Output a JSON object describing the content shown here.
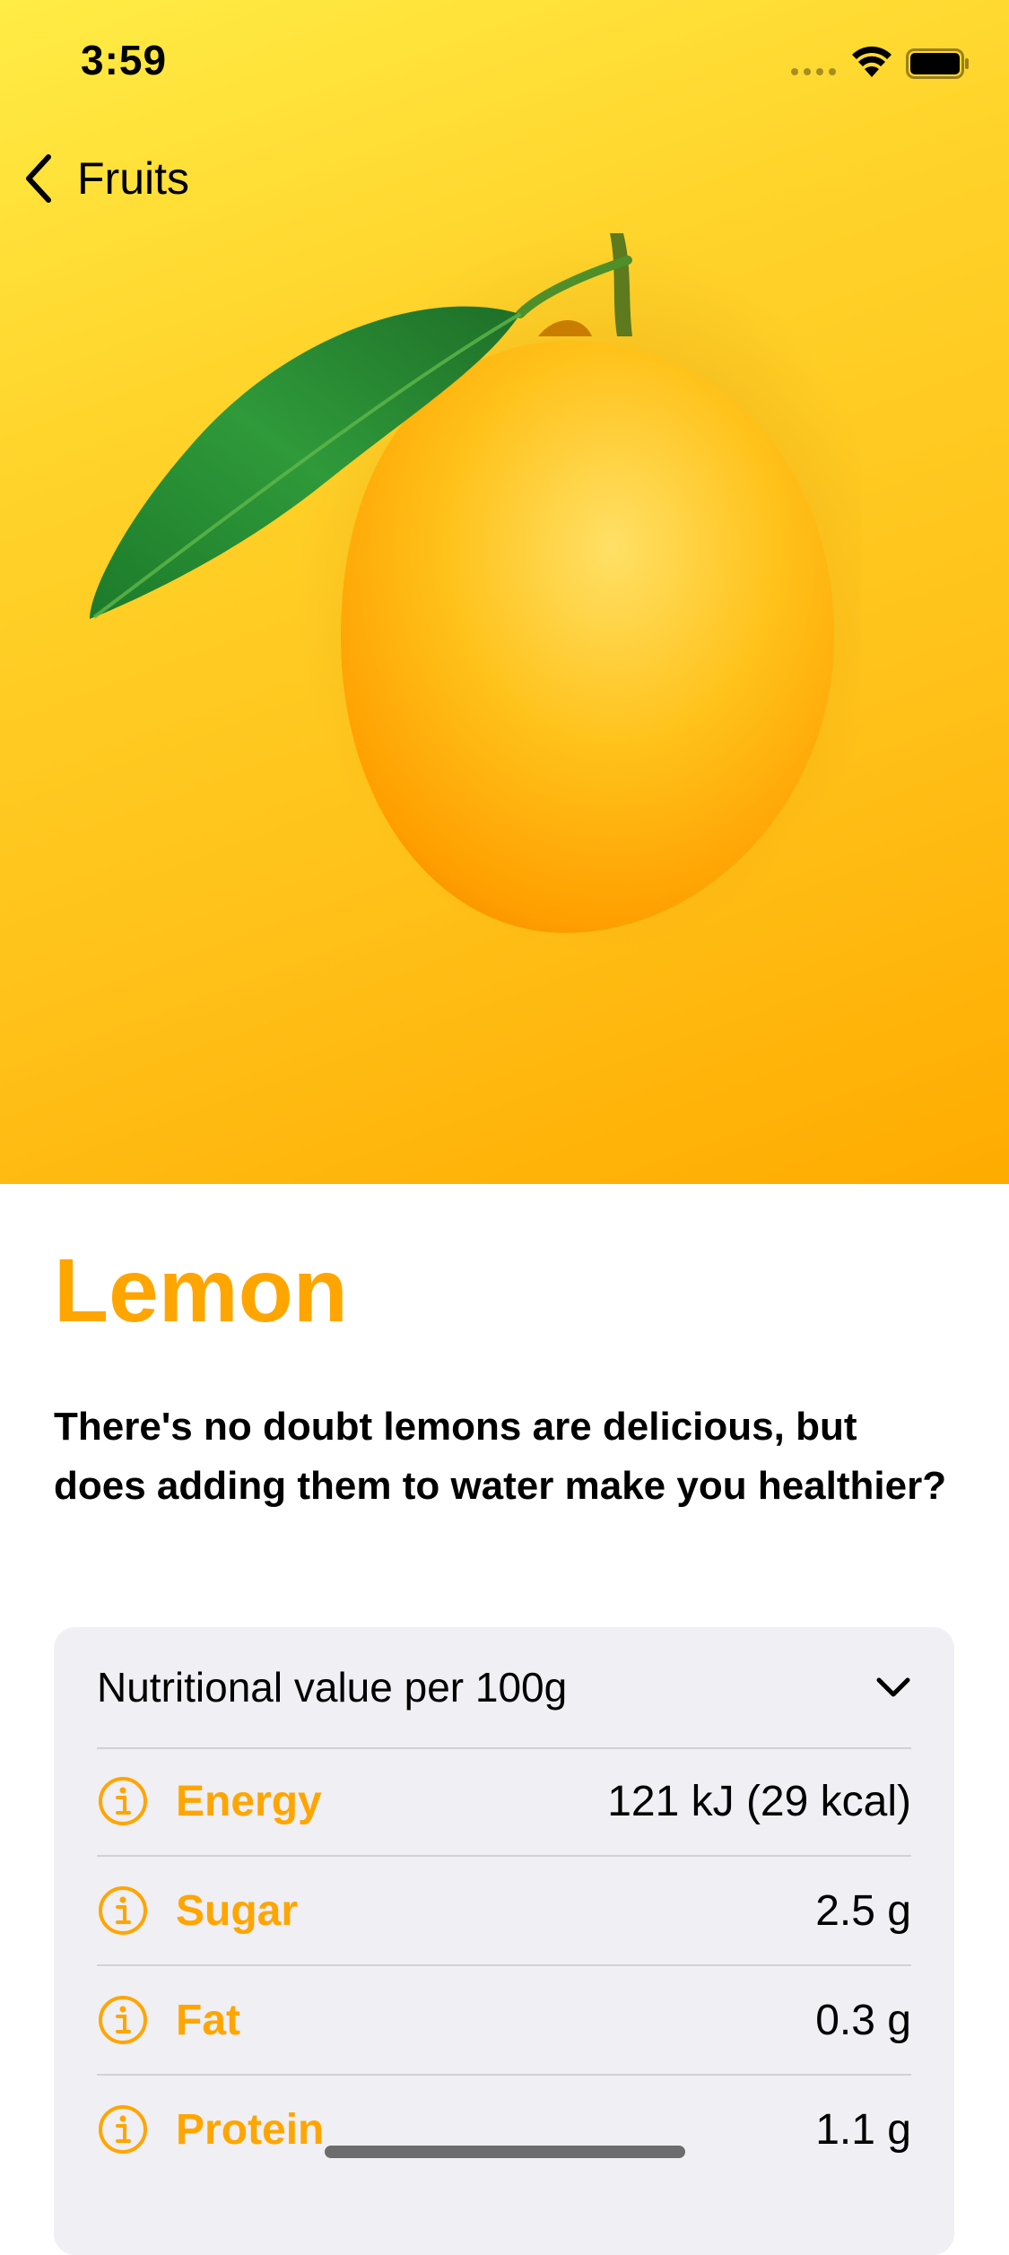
{
  "status_bar": {
    "time": "3:59"
  },
  "nav": {
    "back_label": "Fruits"
  },
  "fruit": {
    "name": "Lemon",
    "description": "There's no doubt lemons are delicious, but does adding them to water make you healthier?"
  },
  "nutrition": {
    "header": "Nutritional value per 100g",
    "rows": [
      {
        "label": "Energy",
        "value": "121 kJ (29 kcal)"
      },
      {
        "label": "Sugar",
        "value": "2.5 g"
      },
      {
        "label": "Fat",
        "value": "0.3 g"
      },
      {
        "label": "Protein",
        "value": "1.1 g"
      }
    ]
  },
  "colors": {
    "accent": "#ffa500",
    "hero_gradient_start": "#ffec45",
    "hero_gradient_end": "#ffab00",
    "card_background": "#efeff4"
  },
  "icons": [
    "chevron-left-icon",
    "chevron-down-icon",
    "info-circle-icon",
    "wifi-icon",
    "battery-icon",
    "cellular-icon"
  ]
}
